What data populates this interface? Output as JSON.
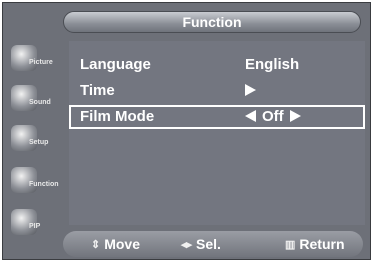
{
  "menu": {
    "title": "Function",
    "items": [
      {
        "label": "Language",
        "value": "English"
      },
      {
        "label": "Time",
        "value": ""
      },
      {
        "label": "Film Mode",
        "value": "Off"
      }
    ]
  },
  "sidebar": {
    "items": [
      {
        "label": "Picture",
        "icon": "picture-icon"
      },
      {
        "label": "Sound",
        "icon": "sound-icon"
      },
      {
        "label": "Setup",
        "icon": "setup-icon"
      },
      {
        "label": "Function",
        "icon": "function-icon"
      },
      {
        "label": "PIP",
        "icon": "pip-icon"
      }
    ]
  },
  "footer": {
    "move": "Move",
    "select": "Sel.",
    "return": "Return"
  },
  "colors": {
    "background": "#737680",
    "text": "#ffffff",
    "highlight_border": "#ffffff"
  }
}
